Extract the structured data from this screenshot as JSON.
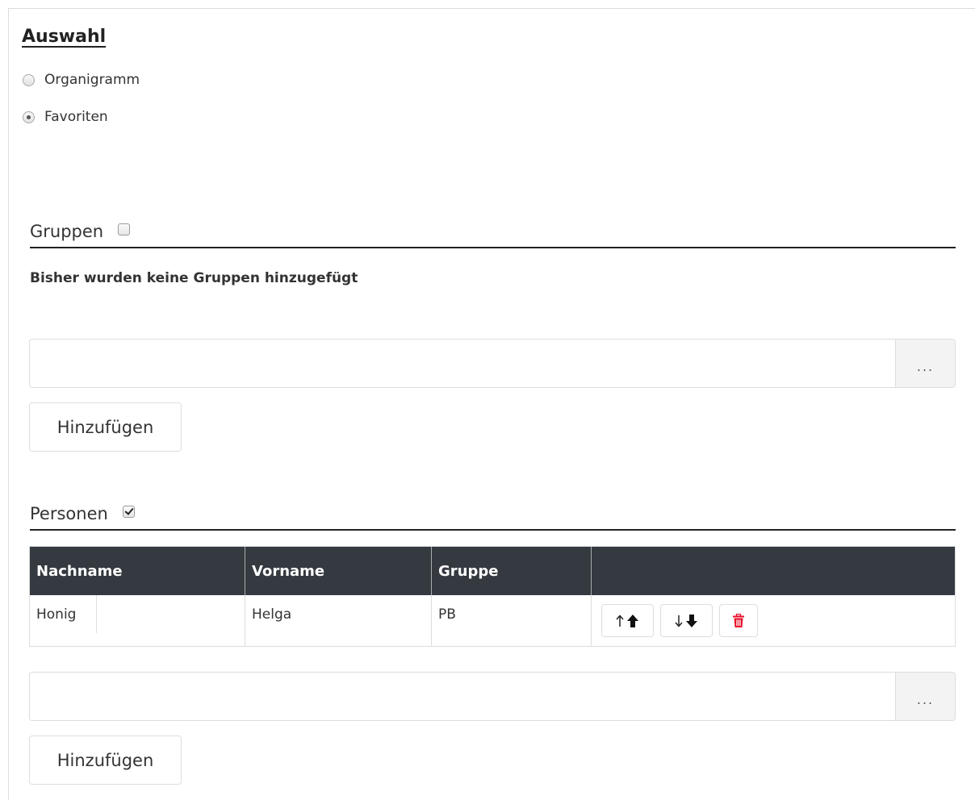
{
  "selection": {
    "title": "Auswahl",
    "options": [
      {
        "label": "Organigramm",
        "selected": false
      },
      {
        "label": "Favoriten",
        "selected": true
      }
    ]
  },
  "groups": {
    "header_label": "Gruppen",
    "checked": false,
    "empty_message": "Bisher wurden keine Gruppen hinzugefügt",
    "input_value": "",
    "browse_label": "...",
    "add_button_label": "Hinzufügen"
  },
  "persons": {
    "header_label": "Personen",
    "checked": true,
    "columns": [
      "Nachname",
      "Vorname",
      "Gruppe",
      ""
    ],
    "rows": [
      {
        "nachname": "Honig",
        "vorname": "Helga",
        "gruppe": "PB"
      }
    ],
    "input_value": "",
    "browse_label": "...",
    "add_button_label": "Hinzufügen"
  },
  "colors": {
    "table_header_bg": "#343a40",
    "delete_icon": "#e8102a"
  },
  "icons": {
    "move_up": "arrow-up-icon",
    "move_down": "arrow-down-icon",
    "delete": "trash-icon"
  }
}
